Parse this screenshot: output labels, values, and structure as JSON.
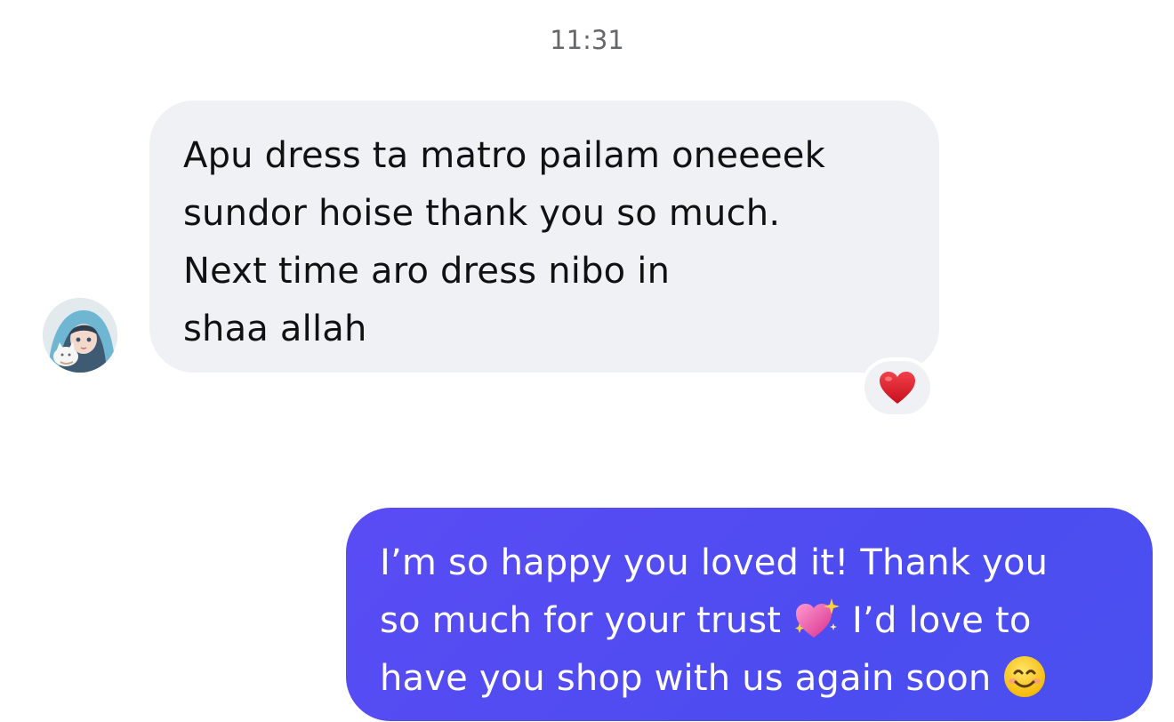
{
  "conversation": {
    "timestamp": "11:31",
    "incoming": {
      "lines": [
        "Apu dress ta matro pailam oneeeek",
        "sundor hoise thank you so much.",
        "Next time aro dress  nibo in",
        "shaa allah"
      ],
      "reaction": "heart-emoji"
    },
    "outgoing": {
      "line1": "I’m so happy you loved it! Thank you",
      "line2_before": "so much for your trust",
      "line2_emoji": "sparkling-heart-emoji",
      "line2_after": "I’d love to",
      "line3_before": "have you shop with us again soon",
      "line3_emoji": "smiling-face-emoji"
    }
  },
  "colors": {
    "incoming_bubble": "#f0f1f5",
    "outgoing_bubble": "#4d4cf0",
    "timestamp_text": "#65676b"
  }
}
